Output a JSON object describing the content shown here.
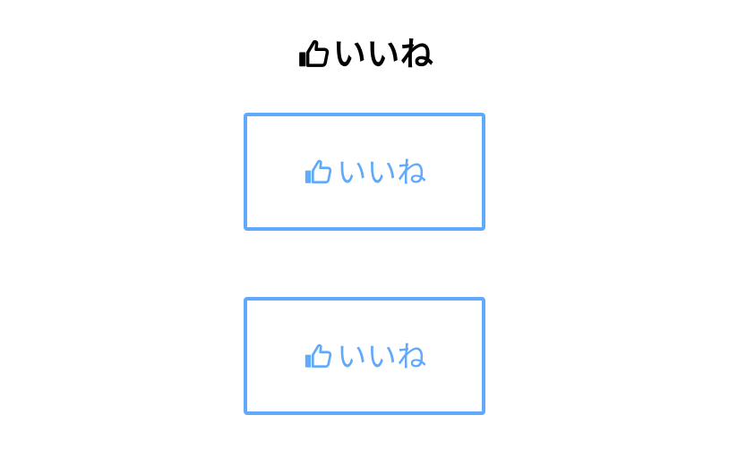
{
  "heading": {
    "icon": "thumbs-up-icon",
    "text": "いいね",
    "color": "#000000"
  },
  "buttons": [
    {
      "icon": "thumbs-up-icon",
      "label": "いいね",
      "color": "#61a9fa"
    },
    {
      "icon": "thumbs-up-icon",
      "label": "いいね",
      "color": "#61a9fa"
    }
  ]
}
